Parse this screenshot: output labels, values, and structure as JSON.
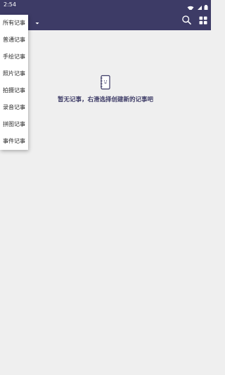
{
  "status_bar": {
    "time": "2:54",
    "icons": [
      "wifi-icon",
      "signal-icon",
      "battery-icon"
    ]
  },
  "app_bar": {
    "background_color": "#3d3b66",
    "icons": [
      "chevron-down-icon",
      "search-icon",
      "grid-view-icon"
    ]
  },
  "category_menu": {
    "items": [
      {
        "label": "所有记事"
      },
      {
        "label": "普通记事"
      },
      {
        "label": "手绘记事"
      },
      {
        "label": "照片记事"
      },
      {
        "label": "拍摄记事"
      },
      {
        "label": "录音记事"
      },
      {
        "label": "拼图记事"
      },
      {
        "label": "事件记事"
      }
    ]
  },
  "empty_state": {
    "icon": "notebook-icon",
    "message": "暂无记事，右滑选择创建新的记事吧"
  }
}
